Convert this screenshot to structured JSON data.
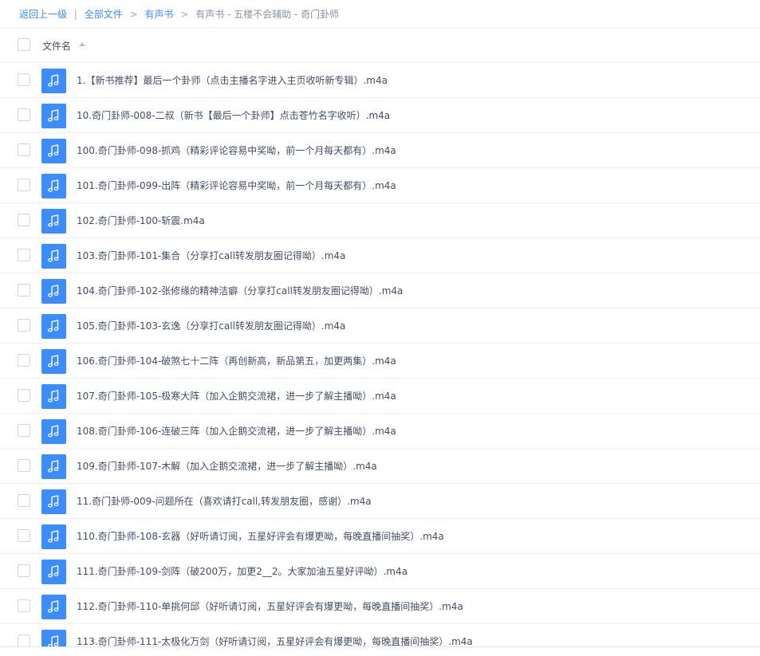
{
  "breadcrumb": {
    "back": "返回上一级",
    "divider": "|",
    "all_files": "全部文件",
    "folder": "有声书",
    "current": "有声书 - 五楼不会辅助 - 奇门卦师"
  },
  "header": {
    "column_name": "文件名"
  },
  "files": [
    "1.【新书推荐】最后一个卦师（点击主播名字进入主页收听新专辑）.m4a",
    "10.奇门卦师-008-二叔（新书【最后一个卦师】点击苍竹名字收听）.m4a",
    "100.奇门卦师-098-抓鸡（精彩评论容易中奖呦，前一个月每天都有）.m4a",
    "101.奇门卦师-099-出阵（精彩评论容易中奖呦，前一个月每天都有）.m4a",
    "102.奇门卦师-100-斩震.m4a",
    "103.奇门卦师-101-集合（分享打call转发朋友圈记得呦）.m4a",
    "104.奇门卦师-102-张修缘的精神洁癖（分享打call转发朋友圈记得呦）.m4a",
    "105.奇门卦师-103-玄逸（分享打call转发朋友圈记得呦）.m4a",
    "106.奇门卦师-104-破煞七十二阵（再创新高，新品第五，加更两集）.m4a",
    "107.奇门卦师-105-极寒大阵（加入企鹅交流裙，进一步了解主播呦）.m4a",
    "108.奇门卦师-106-连破三阵（加入企鹅交流裙，进一步了解主播呦）.m4a",
    "109.奇门卦师-107-木解（加入企鹅交流裙，进一步了解主播呦）.m4a",
    "11.奇门卦师-009-问题所在（喜欢请打call,转发朋友圈，感谢）.m4a",
    "110.奇门卦师-108-玄器（好听请订阅，五星好评会有爆更呦，每晚直播间抽奖）.m4a",
    "111.奇门卦师-109-剑阵（破200万，加更2__2。大家加油五星好评呦）.m4a",
    "112.奇门卦师-110-单挑何邱（好听请订阅，五星好评会有爆更呦，每晚直播间抽奖）.m4a",
    "113.奇门卦师-111-太极化万剑（好听请订阅，五星好评会有爆更呦，每晚直播间抽奖）.m4a"
  ],
  "icons": {
    "file_type": "music-note-icon",
    "sort": "sort-ascending-icon"
  },
  "colors": {
    "link": "#3b8cff",
    "file_icon_bg": "#3b8cff",
    "text": "#424e67"
  }
}
